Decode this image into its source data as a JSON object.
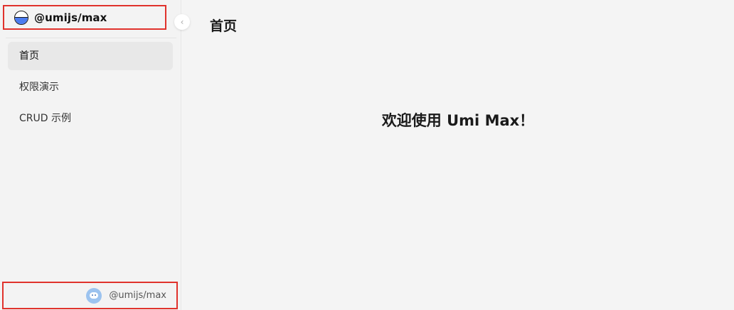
{
  "brand": {
    "title": "@umijs/max",
    "logo_icon": "umi-logo-icon"
  },
  "collapse": {
    "icon": "chevron-left-icon",
    "glyph": "‹"
  },
  "menu": {
    "items": [
      {
        "label": "首页",
        "active": true
      },
      {
        "label": "权限演示",
        "active": false
      },
      {
        "label": "CRUD 示例",
        "active": false
      }
    ]
  },
  "footer": {
    "avatar_icon": "avatar-icon",
    "username": "@umijs/max"
  },
  "main": {
    "page_title": "首页",
    "welcome_text": "欢迎使用 Umi Max！"
  },
  "colors": {
    "highlight_border": "#e0322c",
    "logo_blue": "#4b7cf0",
    "avatar_bg": "#9cc3ef",
    "active_menu_bg": "#e8e8e8"
  }
}
